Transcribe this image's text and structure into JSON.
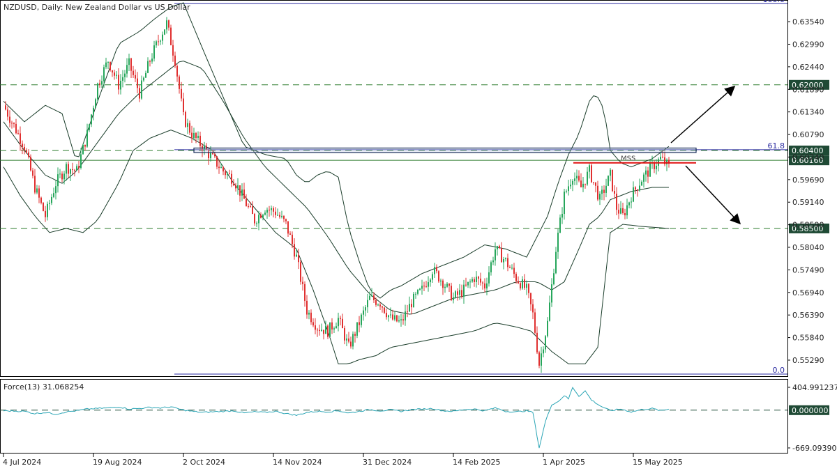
{
  "chart_data": {
    "type": "candlestick",
    "title": "NZDUSD, Daily:  New Zealand Dollar vs US Dollar",
    "price_axis": {
      "min": 0.5495,
      "max": 0.64,
      "ticks": [
        "0.63540",
        "0.62990",
        "0.62440",
        "0.61890",
        "0.61340",
        "0.60790",
        "0.60240",
        "0.59690",
        "0.59140",
        "0.58590",
        "0.58040",
        "0.57490",
        "0.56940",
        "0.56390",
        "0.55840",
        "0.55290"
      ]
    },
    "date_axis": {
      "labels": [
        "4 Jul 2024",
        "19 Aug 2024",
        "2 Oct 2024",
        "14 Nov 2024",
        "31 Dec 2024",
        "14 Feb 2025",
        "1 Apr 2025",
        "15 May 2025"
      ]
    },
    "fibonacci": {
      "levels": [
        {
          "label": "100.0",
          "value": 0.6398
        },
        {
          "label": "61.8",
          "value": 0.6042
        },
        {
          "label": "0.0",
          "value": 0.5495
        }
      ]
    },
    "horizontal_levels": [
      {
        "label": "0.62000",
        "value": 0.62,
        "style": "dashed"
      },
      {
        "label": "0.60400",
        "value": 0.604,
        "style": "dashed"
      },
      {
        "label": "0.60160",
        "value": 0.6016,
        "style": "solid"
      },
      {
        "label": "0.58500",
        "value": 0.585,
        "style": "dashed"
      }
    ],
    "annotations": {
      "mss_label": "MSS",
      "zone": {
        "from": 0.6035,
        "to": 0.6046
      },
      "mss_level": 0.601
    },
    "colors": {
      "bull": "#26a65b",
      "bear": "#e03030",
      "band": "#1a3d2a",
      "force": "#2aa5b5",
      "fib": "#2a2aa0",
      "level": "#2a7a2a",
      "label_bg": "#1f4a35"
    },
    "close_path": [
      [
        0,
        0.615
      ],
      [
        10,
        0.605
      ],
      [
        15,
        0.595
      ],
      [
        20,
        0.588
      ],
      [
        25,
        0.596
      ],
      [
        30,
        0.6
      ],
      [
        35,
        0.599
      ],
      [
        40,
        0.608
      ],
      [
        45,
        0.62
      ],
      [
        50,
        0.626
      ],
      [
        55,
        0.62
      ],
      [
        60,
        0.625
      ],
      [
        65,
        0.618
      ],
      [
        70,
        0.626
      ],
      [
        75,
        0.632
      ],
      [
        78,
        0.635
      ],
      [
        82,
        0.626
      ],
      [
        86,
        0.612
      ],
      [
        90,
        0.608
      ],
      [
        95,
        0.605
      ],
      [
        100,
        0.602
      ],
      [
        105,
        0.599
      ],
      [
        110,
        0.597
      ],
      [
        115,
        0.592
      ],
      [
        120,
        0.587
      ],
      [
        125,
        0.59
      ],
      [
        130,
        0.589
      ],
      [
        135,
        0.586
      ],
      [
        140,
        0.578
      ],
      [
        145,
        0.565
      ],
      [
        150,
        0.561
      ],
      [
        155,
        0.56
      ],
      [
        160,
        0.563
      ],
      [
        165,
        0.556
      ],
      [
        170,
        0.562
      ],
      [
        175,
        0.568
      ],
      [
        180,
        0.567
      ],
      [
        185,
        0.563
      ],
      [
        190,
        0.562
      ],
      [
        195,
        0.567
      ],
      [
        200,
        0.57
      ],
      [
        205,
        0.575
      ],
      [
        210,
        0.572
      ],
      [
        215,
        0.568
      ],
      [
        220,
        0.57
      ],
      [
        225,
        0.573
      ],
      [
        230,
        0.571
      ],
      [
        235,
        0.58
      ],
      [
        240,
        0.577
      ],
      [
        245,
        0.573
      ],
      [
        250,
        0.57
      ],
      [
        253,
        0.564
      ],
      [
        256,
        0.552
      ],
      [
        260,
        0.562
      ],
      [
        264,
        0.58
      ],
      [
        268,
        0.593
      ],
      [
        272,
        0.598
      ],
      [
        276,
        0.595
      ],
      [
        280,
        0.599
      ],
      [
        285,
        0.592
      ],
      [
        290,
        0.598
      ],
      [
        293,
        0.59
      ],
      [
        296,
        0.588
      ],
      [
        300,
        0.593
      ],
      [
        305,
        0.597
      ],
      [
        310,
        0.6
      ],
      [
        314,
        0.602
      ],
      [
        318,
        0.6
      ]
    ],
    "bands": {
      "upper": [
        [
          0,
          0.616
        ],
        [
          10,
          0.611
        ],
        [
          20,
          0.615
        ],
        [
          28,
          0.613
        ],
        [
          35,
          0.601
        ],
        [
          45,
          0.616
        ],
        [
          55,
          0.63
        ],
        [
          65,
          0.633
        ],
        [
          72,
          0.636
        ],
        [
          80,
          0.639
        ],
        [
          86,
          0.64
        ],
        [
          95,
          0.629
        ],
        [
          105,
          0.617
        ],
        [
          115,
          0.605
        ],
        [
          125,
          0.603
        ],
        [
          135,
          0.602
        ],
        [
          140,
          0.598
        ],
        [
          145,
          0.596
        ],
        [
          150,
          0.598
        ],
        [
          155,
          0.599
        ],
        [
          160,
          0.5975
        ],
        [
          165,
          0.585
        ],
        [
          170,
          0.577
        ],
        [
          175,
          0.57
        ],
        [
          180,
          0.568
        ],
        [
          185,
          0.57
        ],
        [
          190,
          0.571
        ],
        [
          200,
          0.574
        ],
        [
          210,
          0.576
        ],
        [
          220,
          0.578
        ],
        [
          230,
          0.581
        ],
        [
          240,
          0.58
        ],
        [
          250,
          0.578
        ],
        [
          260,
          0.588
        ],
        [
          265,
          0.596
        ],
        [
          270,
          0.603
        ],
        [
          275,
          0.608
        ],
        [
          280,
          0.616
        ],
        [
          283,
          0.618
        ],
        [
          287,
          0.614
        ],
        [
          290,
          0.604
        ],
        [
          295,
          0.601
        ],
        [
          300,
          0.6
        ],
        [
          310,
          0.602
        ],
        [
          318,
          0.605
        ]
      ],
      "middle": [
        [
          0,
          0.611
        ],
        [
          10,
          0.604
        ],
        [
          20,
          0.598
        ],
        [
          28,
          0.596
        ],
        [
          35,
          0.599
        ],
        [
          45,
          0.606
        ],
        [
          55,
          0.613
        ],
        [
          65,
          0.618
        ],
        [
          75,
          0.622
        ],
        [
          85,
          0.626
        ],
        [
          95,
          0.624
        ],
        [
          105,
          0.616
        ],
        [
          115,
          0.607
        ],
        [
          125,
          0.6
        ],
        [
          135,
          0.595
        ],
        [
          145,
          0.59
        ],
        [
          155,
          0.583
        ],
        [
          165,
          0.575
        ],
        [
          175,
          0.569
        ],
        [
          185,
          0.565
        ],
        [
          195,
          0.564
        ],
        [
          205,
          0.566
        ],
        [
          215,
          0.568
        ],
        [
          225,
          0.569
        ],
        [
          235,
          0.57
        ],
        [
          245,
          0.572
        ],
        [
          255,
          0.572
        ],
        [
          262,
          0.57
        ],
        [
          268,
          0.572
        ],
        [
          275,
          0.58
        ],
        [
          280,
          0.586
        ],
        [
          285,
          0.588
        ],
        [
          290,
          0.592
        ],
        [
          300,
          0.594
        ],
        [
          310,
          0.595
        ],
        [
          318,
          0.595
        ]
      ],
      "lower": [
        [
          0,
          0.6
        ],
        [
          8,
          0.593
        ],
        [
          15,
          0.588
        ],
        [
          22,
          0.584
        ],
        [
          30,
          0.585
        ],
        [
          38,
          0.584
        ],
        [
          45,
          0.587
        ],
        [
          55,
          0.596
        ],
        [
          62,
          0.604
        ],
        [
          70,
          0.607
        ],
        [
          80,
          0.609
        ],
        [
          90,
          0.607
        ],
        [
          100,
          0.604
        ],
        [
          110,
          0.596
        ],
        [
          120,
          0.59
        ],
        [
          130,
          0.584
        ],
        [
          140,
          0.58
        ],
        [
          148,
          0.57
        ],
        [
          155,
          0.56
        ],
        [
          160,
          0.552
        ],
        [
          165,
          0.552
        ],
        [
          170,
          0.553
        ],
        [
          178,
          0.554
        ],
        [
          185,
          0.556
        ],
        [
          195,
          0.557
        ],
        [
          205,
          0.558
        ],
        [
          215,
          0.559
        ],
        [
          225,
          0.56
        ],
        [
          235,
          0.562
        ],
        [
          245,
          0.561
        ],
        [
          252,
          0.56
        ],
        [
          256,
          0.558
        ],
        [
          262,
          0.555
        ],
        [
          270,
          0.552
        ],
        [
          278,
          0.552
        ],
        [
          284,
          0.556
        ],
        [
          290,
          0.584
        ],
        [
          296,
          0.586
        ],
        [
          305,
          0.5855
        ],
        [
          318,
          0.585
        ]
      ]
    },
    "force_index": {
      "label": "Force(13) 31.068254",
      "scale_labels": [
        "404.991237",
        "0.000000",
        "-669.09390"
      ],
      "max": 404.991237,
      "min": -669.0939,
      "values": [
        [
          0,
          -10
        ],
        [
          10,
          -20
        ],
        [
          15,
          -60
        ],
        [
          20,
          -40
        ],
        [
          25,
          -70
        ],
        [
          30,
          -30
        ],
        [
          35,
          -10
        ],
        [
          40,
          20
        ],
        [
          45,
          30
        ],
        [
          50,
          40
        ],
        [
          55,
          60
        ],
        [
          60,
          20
        ],
        [
          65,
          30
        ],
        [
          70,
          50
        ],
        [
          75,
          40
        ],
        [
          80,
          60
        ],
        [
          85,
          10
        ],
        [
          90,
          -20
        ],
        [
          95,
          -40
        ],
        [
          100,
          -30
        ],
        [
          105,
          -20
        ],
        [
          110,
          -10
        ],
        [
          115,
          -50
        ],
        [
          120,
          -30
        ],
        [
          125,
          -40
        ],
        [
          130,
          -20
        ],
        [
          135,
          -60
        ],
        [
          140,
          -90
        ],
        [
          145,
          -40
        ],
        [
          150,
          -20
        ],
        [
          155,
          -30
        ],
        [
          160,
          -10
        ],
        [
          165,
          -50
        ],
        [
          170,
          -20
        ],
        [
          175,
          10
        ],
        [
          180,
          -10
        ],
        [
          185,
          5
        ],
        [
          190,
          -20
        ],
        [
          195,
          10
        ],
        [
          200,
          20
        ],
        [
          205,
          30
        ],
        [
          210,
          -10
        ],
        [
          215,
          -20
        ],
        [
          220,
          10
        ],
        [
          225,
          20
        ],
        [
          230,
          -10
        ],
        [
          235,
          40
        ],
        [
          240,
          -20
        ],
        [
          245,
          -30
        ],
        [
          250,
          -10
        ],
        [
          253,
          -40
        ],
        [
          256,
          -669
        ],
        [
          259,
          -200
        ],
        [
          262,
          100
        ],
        [
          265,
          150
        ],
        [
          268,
          260
        ],
        [
          270,
          200
        ],
        [
          272,
          405
        ],
        [
          275,
          250
        ],
        [
          278,
          340
        ],
        [
          281,
          180
        ],
        [
          285,
          80
        ],
        [
          290,
          -10
        ],
        [
          295,
          20
        ],
        [
          300,
          -30
        ],
        [
          305,
          10
        ],
        [
          310,
          30
        ],
        [
          314,
          -10
        ],
        [
          318,
          20
        ]
      ]
    }
  }
}
